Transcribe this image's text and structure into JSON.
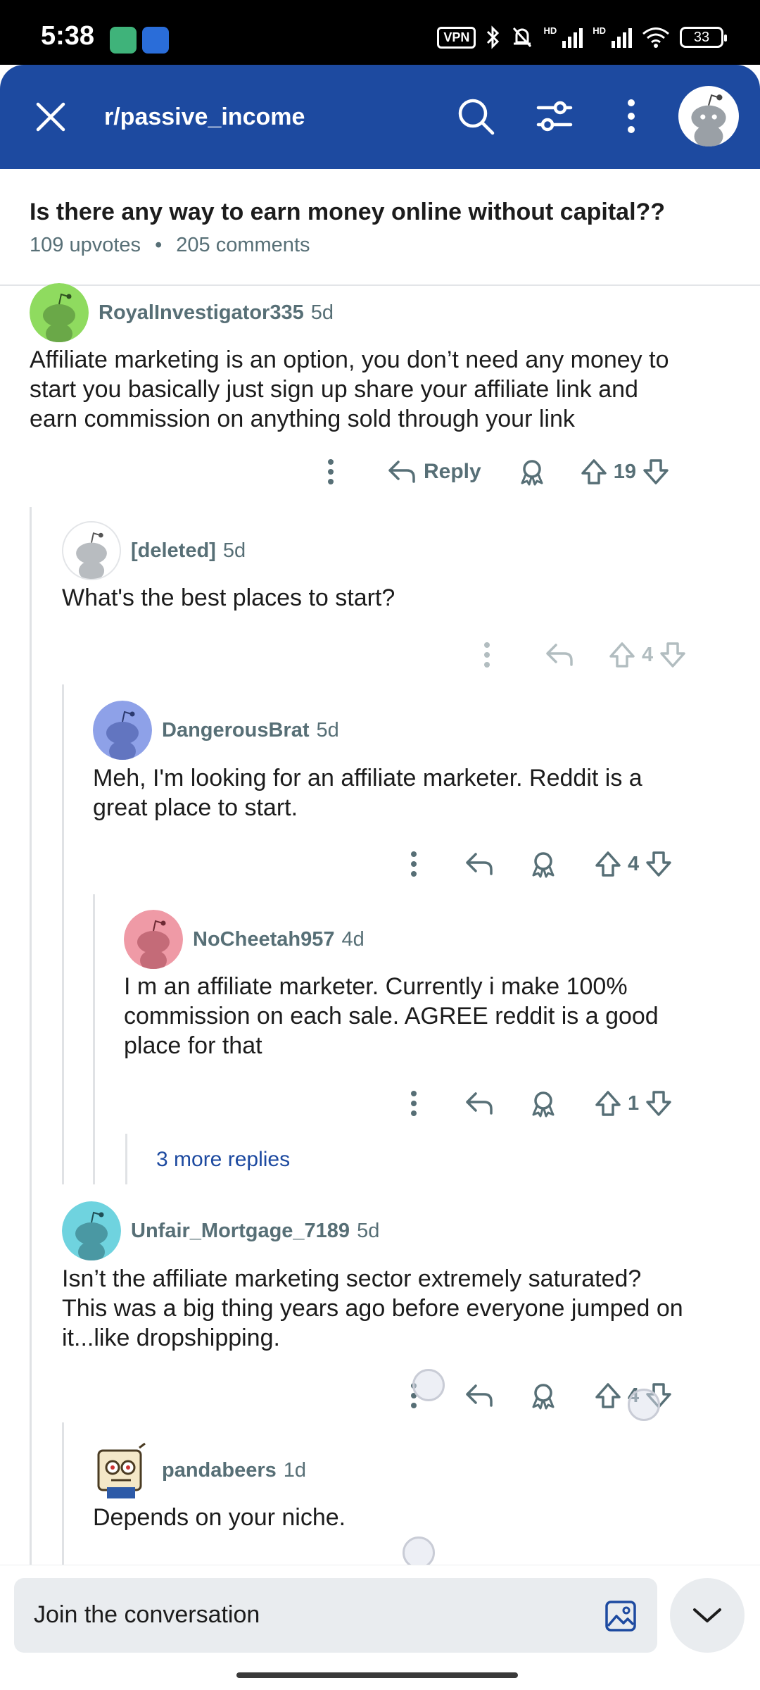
{
  "status_bar": {
    "time": "5:38",
    "vpn_label": "VPN",
    "hd_label_1": "HD",
    "hd_label_2": "HD",
    "battery": "33"
  },
  "header": {
    "subreddit": "r/passive_income"
  },
  "post": {
    "title": "Is there any way to earn money online without capital??",
    "upvotes": "109 upvotes",
    "separator": "•",
    "comments": "205 comments"
  },
  "comments": [
    {
      "username": "RoyalInvestigator335",
      "age": "5d",
      "avatar_color": "#8fdb5f",
      "body_lines": [
        "Affiliate marketing is an option, you don’t need any money to",
        "start you basically just sign up share your affiliate link and",
        "earn commission on anything sold through your link"
      ],
      "reply_label": "Reply",
      "votes": "19"
    },
    {
      "username": "[deleted]",
      "age": "5d",
      "avatar_color": "#ffffff",
      "body_lines": [
        "What's the best places to start?"
      ],
      "votes": "4"
    },
    {
      "username": "DangerousBrat",
      "age": "5d",
      "avatar_color": "#8ea1e8",
      "body_lines": [
        "Meh, I'm looking for an affiliate marketer. Reddit is a",
        "great place to start."
      ],
      "votes": "4"
    },
    {
      "username": "NoCheetah957",
      "age": "4d",
      "avatar_color": "#ef9aa6",
      "body_lines": [
        "I m an affiliate marketer. Currently i make 100%",
        "commission on each sale. AGREE reddit is a good",
        "place for that"
      ],
      "votes": "1"
    },
    {
      "username": "Unfair_Mortgage_7189",
      "age": "5d",
      "avatar_color": "#6fd3df",
      "body_lines": [
        "Isn’t the affiliate marketing sector extremely saturated?",
        "This was a big thing years ago before everyone jumped on",
        "it...like dropshipping."
      ],
      "votes": "4"
    },
    {
      "username": "pandabeers",
      "age": "1d",
      "avatar_color": "#f4e8c8",
      "body_lines": [
        "Depends on your niche."
      ]
    }
  ],
  "more_replies": "3 more replies",
  "composer": {
    "placeholder": "Join the conversation"
  },
  "colors": {
    "header_bg": "#1d4aa0",
    "meta_text": "#576f76",
    "link": "#1d4aa0"
  },
  "icons": [
    "close-icon",
    "search-icon",
    "filter-icon",
    "more-vertical-icon",
    "avatar-icon",
    "reply-icon",
    "award-icon",
    "upvote-icon",
    "downvote-icon",
    "image-icon",
    "chevron-down-icon"
  ]
}
